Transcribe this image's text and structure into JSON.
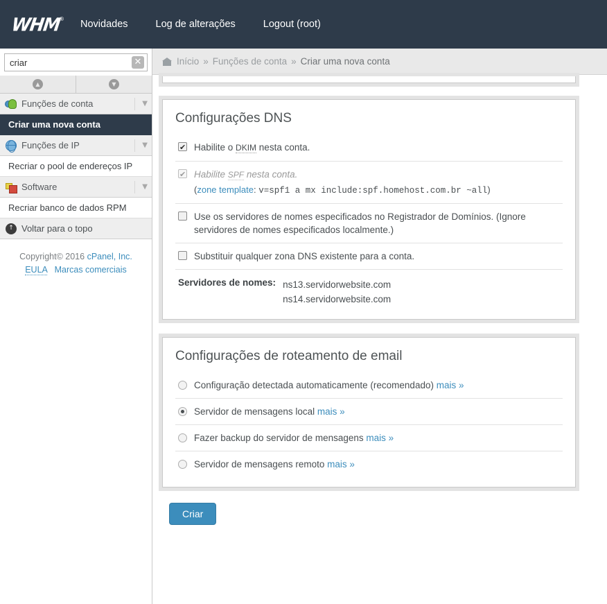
{
  "header": {
    "logo_text": "WHM",
    "logo_registered": "®",
    "nav": [
      {
        "label": "Novidades",
        "name": "nav-novidades"
      },
      {
        "label": "Log de alterações",
        "name": "nav-log-alteracoes"
      },
      {
        "label": "Logout (root)",
        "name": "nav-logout"
      }
    ]
  },
  "sidebar": {
    "search": {
      "value": "criar",
      "placeholder": "",
      "clear_glyph": "✕"
    },
    "scroll_up_glyph": "▲",
    "scroll_down_glyph": "▼",
    "chevron_glyph": "▼",
    "groups": [
      {
        "label": "Funções de conta",
        "icon": "users-icon",
        "items": [
          {
            "label": "Criar uma nova conta",
            "active": true
          }
        ]
      },
      {
        "label": "Funções de IP",
        "icon": "globe-icon",
        "items": [
          {
            "label": "Recriar o pool de endereços IP",
            "active": false
          }
        ]
      },
      {
        "label": "Software",
        "icon": "software-icon",
        "items": [
          {
            "label": "Recriar banco de dados RPM",
            "active": false
          }
        ]
      }
    ],
    "back_to_top": {
      "label": "Voltar para o topo",
      "icon": "up-arrow-icon",
      "glyph": "↑"
    },
    "footer": {
      "copyright_prefix": "Copyright© 2016 ",
      "company": "cPanel, Inc.",
      "eula": "EULA",
      "trademarks": "Marcas comerciais"
    }
  },
  "breadcrumb": {
    "home": "Início",
    "section": "Funções de conta",
    "current": "Criar uma nova conta",
    "separator": "»"
  },
  "dns_panel": {
    "title": "Configurações DNS",
    "dkim": {
      "checked": true,
      "text_before": "Habilite o ",
      "abbr": "DKIM",
      "text_after": " nesta conta."
    },
    "spf": {
      "checked": true,
      "disabled": true,
      "text_before": "Habilite ",
      "abbr": "SPF",
      "text_after": " nesta conta.",
      "zone_open": "(",
      "zone_link": "zone template",
      "zone_colon": ": ",
      "zone_value": "v=spf1 a mx include:spf.homehost.com.br ~all",
      "zone_close": ")"
    },
    "registrar_ns": {
      "checked": false,
      "label": "Use os servidores de nomes especificados no Registrador de Domínios. (Ignore servidores de nomes especificados localmente.)"
    },
    "overwrite_zone": {
      "checked": false,
      "label": "Substituir qualquer zona DNS existente para a conta."
    },
    "nameservers": {
      "label": "Servidores de nomes:",
      "values": [
        "ns13.servidorwebsite.com",
        "ns14.servidorwebsite.com"
      ]
    }
  },
  "email_panel": {
    "title": "Configurações de roteamento de email",
    "more_label": "mais »",
    "options": [
      {
        "label": "Configuração detectada automaticamente (recomendado)",
        "selected": false
      },
      {
        "label": "Servidor de mensagens local",
        "selected": true
      },
      {
        "label": "Fazer backup do servidor de mensagens",
        "selected": false
      },
      {
        "label": "Servidor de mensagens remoto",
        "selected": false
      }
    ]
  },
  "submit": {
    "label": "Criar"
  },
  "colors": {
    "header_bg": "#2e3b4a",
    "accent_link": "#3c8dbc",
    "button_primary": "#3c8dbc",
    "panel_frame": "#e3e3e3",
    "breadcrumb_bg": "#e9e9e9"
  }
}
